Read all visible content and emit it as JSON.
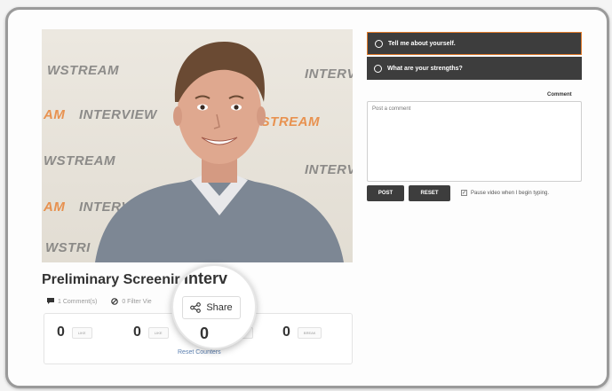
{
  "video": {
    "watermarks": [
      {
        "pre": "WSTREAM",
        "hi": ""
      },
      {
        "pre": "INTERV",
        "hi": ""
      },
      {
        "pre": "",
        "hi": "AM"
      },
      {
        "pre": "INTERVIEW",
        "hi": ""
      },
      {
        "pre": "",
        "hi": "WSTREAM"
      },
      {
        "pre": "WSTREAM",
        "hi": ""
      },
      {
        "pre": "INTERV",
        "hi": ""
      },
      {
        "pre": "",
        "hi": "AM"
      },
      {
        "pre": "INTERV",
        "hi": ""
      },
      {
        "pre": "WSTRI",
        "hi": ""
      }
    ]
  },
  "interview": {
    "title": "Preliminary Screenir",
    "comments": "1 Comment(s)",
    "filter": "0 Filter Vie"
  },
  "counters": [
    {
      "value": "0",
      "label": "like"
    },
    {
      "value": "0",
      "label": "like"
    },
    {
      "value": "0",
      "label": "maybe"
    },
    {
      "value": "0",
      "label": "break"
    }
  ],
  "reset_counters": "Reset Counters",
  "magnifier": {
    "title_fragment": "Interv",
    "share_label": "Share",
    "zero": "0"
  },
  "questions": [
    {
      "label": "Tell me about yourself."
    },
    {
      "label": "What are your strengths?"
    }
  ],
  "comment": {
    "label": "Comment",
    "placeholder": "Post a comment"
  },
  "buttons": {
    "post": "POST",
    "reset": "RESET"
  },
  "pause_label": "Pause video when I begin typing.",
  "colors": {
    "question_bg": "#3d3d3d",
    "accent": "#e07a2a",
    "link": "#5b7fb0"
  }
}
